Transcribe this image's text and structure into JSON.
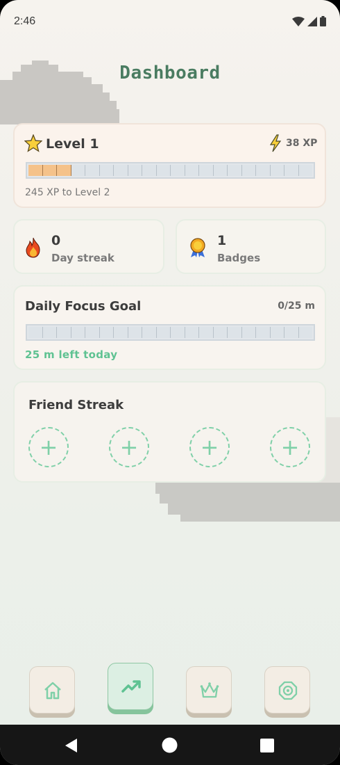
{
  "status_bar": {
    "time": "2:46"
  },
  "page": {
    "title": "Dashboard"
  },
  "level": {
    "label": "Level 1",
    "xp": "38 XP",
    "progress_filled_segments": 3,
    "progress_total_segments": 20,
    "next_text": "245 XP to Level 2"
  },
  "streak": {
    "value": "0",
    "label": "Day streak"
  },
  "badges": {
    "value": "1",
    "label": "Badges"
  },
  "focus_goal": {
    "title": "Daily Focus Goal",
    "progress_text": "0/25 m",
    "progress_fraction": 0,
    "total_segments": 20,
    "remaining_text": "25 m left today"
  },
  "friend_streak": {
    "title": "Friend Streak",
    "slots": [
      "+",
      "+",
      "+",
      "+"
    ]
  },
  "bottom_nav": {
    "items": [
      {
        "icon": "home-icon"
      },
      {
        "icon": "trending-up-icon",
        "active": true
      },
      {
        "icon": "crown-icon"
      },
      {
        "icon": "focus-target-icon"
      }
    ]
  },
  "colors": {
    "accent_green": "#4a7c61",
    "mint": "#7fd0a8",
    "progress_fill": "#f5c28a"
  }
}
